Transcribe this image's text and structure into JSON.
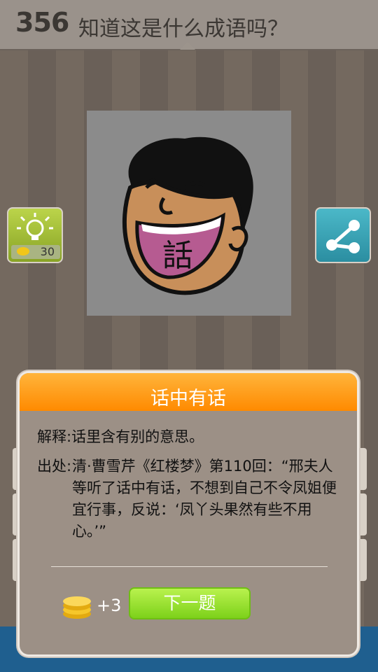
{
  "header": {
    "level": "356",
    "question": "知道这是什么成语吗？"
  },
  "puzzle": {
    "glyph": "話"
  },
  "hint": {
    "cost": "30"
  },
  "modal": {
    "title": "话中有话",
    "explain": "解释:话里含有别的意思。",
    "source_label": "出处:",
    "source_text": "清·曹雪芹《红楼梦》第110回：“邢夫人等听了话中有话，不想到自己不令凤姐便宜行事，反说：‘凤丫头果然有些不用心。’”",
    "reward": "+3",
    "next_label": "下一题"
  },
  "colors": {
    "header_orange": "#ff8a00",
    "button_green": "#7dd11a",
    "share_blue": "#2b8ea1",
    "hint_green": "#88a325"
  },
  "icons": [
    "bulb-icon",
    "coin-icon",
    "share-icon",
    "coins-icon"
  ]
}
